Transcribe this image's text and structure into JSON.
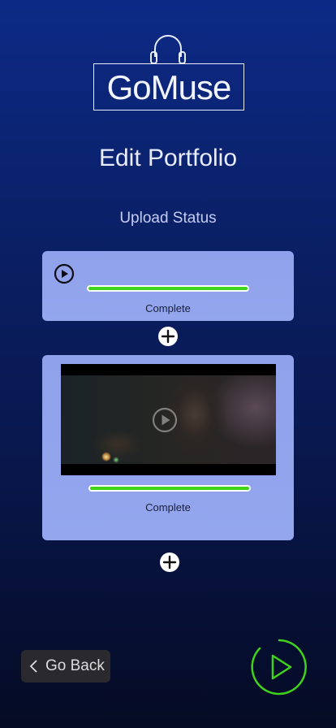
{
  "app": {
    "logo_text": "GoMuse"
  },
  "page": {
    "title": "Edit Portfolio",
    "subtitle": "Upload Status"
  },
  "uploads": [
    {
      "type": "audio",
      "progress": 1.0,
      "status": "Complete"
    },
    {
      "type": "video",
      "progress": 1.0,
      "status": "Complete"
    }
  ],
  "nav": {
    "back_label": "Go Back"
  },
  "colors": {
    "accent": "#3fd41a",
    "card": "#93a6ee",
    "background_top": "#0c2a86",
    "background_bottom": "#050b24"
  },
  "icons": {
    "logo": "headphones-icon",
    "audio": "play-circle-icon",
    "video": "video-play-icon",
    "add": "plus-circle-icon",
    "back": "chevron-left-icon",
    "next": "play-next-icon"
  }
}
